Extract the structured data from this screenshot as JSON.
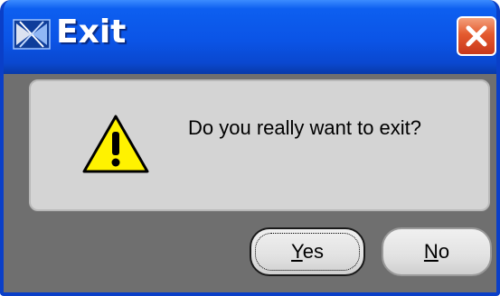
{
  "window": {
    "title": "Exit",
    "close_icon": "close-icon",
    "app_icon": "app-icon"
  },
  "message": {
    "icon": "warning-icon",
    "text": "Do you really want to exit?"
  },
  "buttons": {
    "yes": {
      "mnemonic": "Y",
      "rest": "es",
      "focused": true
    },
    "no": {
      "mnemonic": "N",
      "rest": "o",
      "focused": false
    }
  },
  "colors": {
    "titlebar": "#0b54e6",
    "close": "#e45a2e",
    "panel": "#d4d4d4",
    "body": "#6f6f6f",
    "warning": "#fff200"
  }
}
